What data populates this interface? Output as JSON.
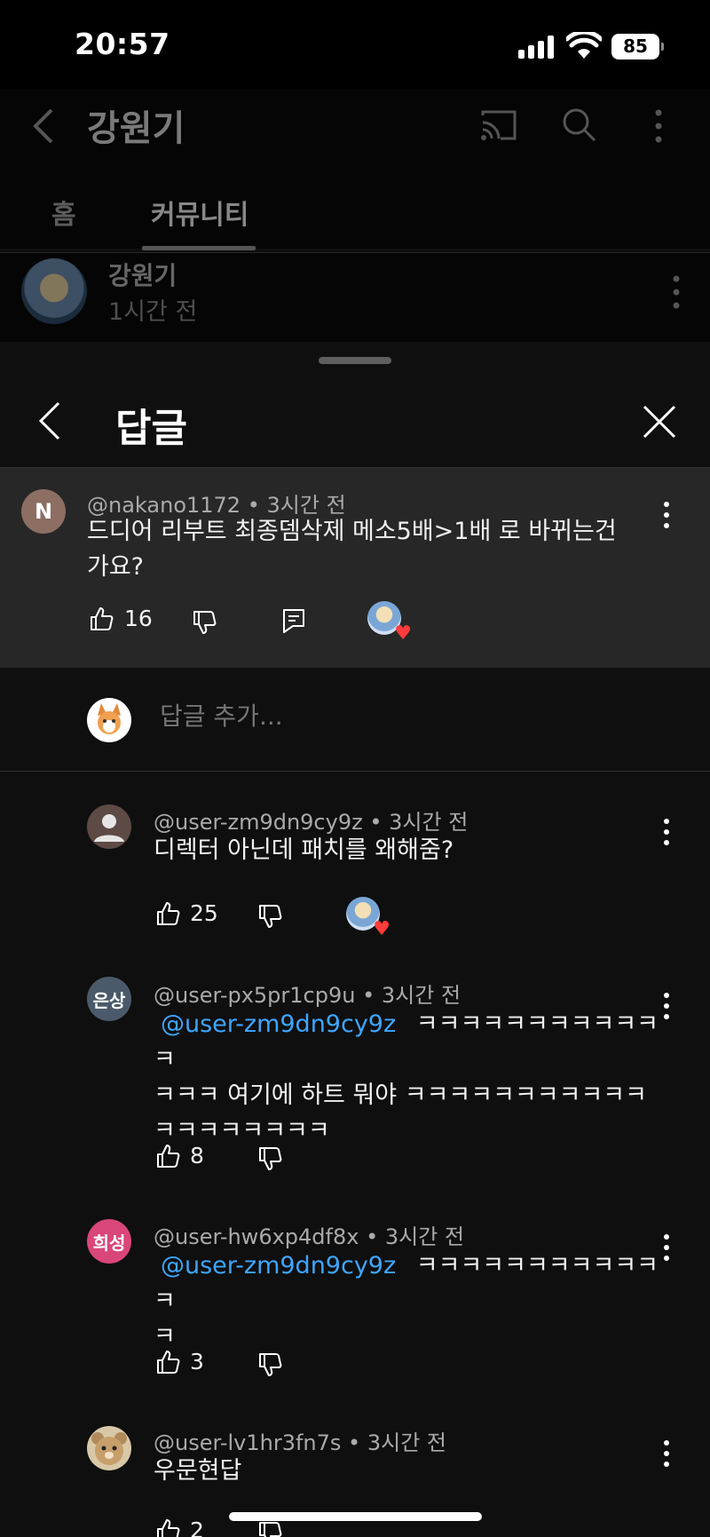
{
  "status_bar": {
    "time": "20:57",
    "battery": "85"
  },
  "channel": {
    "title": "강원기",
    "tabs": [
      {
        "label": "홈"
      },
      {
        "label": "커뮤니티"
      }
    ],
    "post": {
      "author": "강원기",
      "time": "1시간 전"
    }
  },
  "sheet": {
    "title": "답글",
    "parent_comment": {
      "author": "@nakano1172",
      "time": "3시간 전",
      "avatar_letter": "N",
      "text": "드디어 리부트 최종뎀삭제 메소5배>1배 로 바뀌는건가요?",
      "likes": "16"
    },
    "composer": {
      "placeholder": "답글 추가..."
    },
    "replies": [
      {
        "author": "@user-zm9dn9cy9z",
        "time": "3시간 전",
        "text": "디렉터 아닌데 패치를 왜해줌?",
        "likes": "25",
        "hearted": true
      },
      {
        "author": "@user-px5pr1cp9u",
        "time": "3시간 전",
        "avatar_letter": "은상",
        "avatar_color": "#4a5a6a",
        "mention": "@user-zm9dn9cy9z",
        "text_line1": "ㅋㅋㅋㅋㅋㅋㅋㅋㅋㅋㅋㅋ",
        "text_rest": "ㅋㅋㅋ 여기에 하트 뭐야 ㅋㅋㅋㅋㅋㅋㅋㅋㅋㅋㅋ ㅋㅋㅋㅋㅋㅋㅋㅋ",
        "likes": "8"
      },
      {
        "author": "@user-hw6xp4df8x",
        "time": "3시간 전",
        "avatar_letter": "희성",
        "avatar_color": "#d9467a",
        "mention": "@user-zm9dn9cy9z",
        "text_line1": "ㅋㅋㅋㅋㅋㅋㅋㅋㅋㅋㅋㅋ",
        "text_rest": "ㅋ",
        "likes": "3"
      },
      {
        "author": "@user-lv1hr3fn7s",
        "time": "3시간 전",
        "text": "우문현답",
        "likes": "2"
      }
    ]
  },
  "colors": {
    "background": "#0f0f0f",
    "highlight": "#272727",
    "mention": "#3ea6ff",
    "heart": "#ff3b3b"
  }
}
